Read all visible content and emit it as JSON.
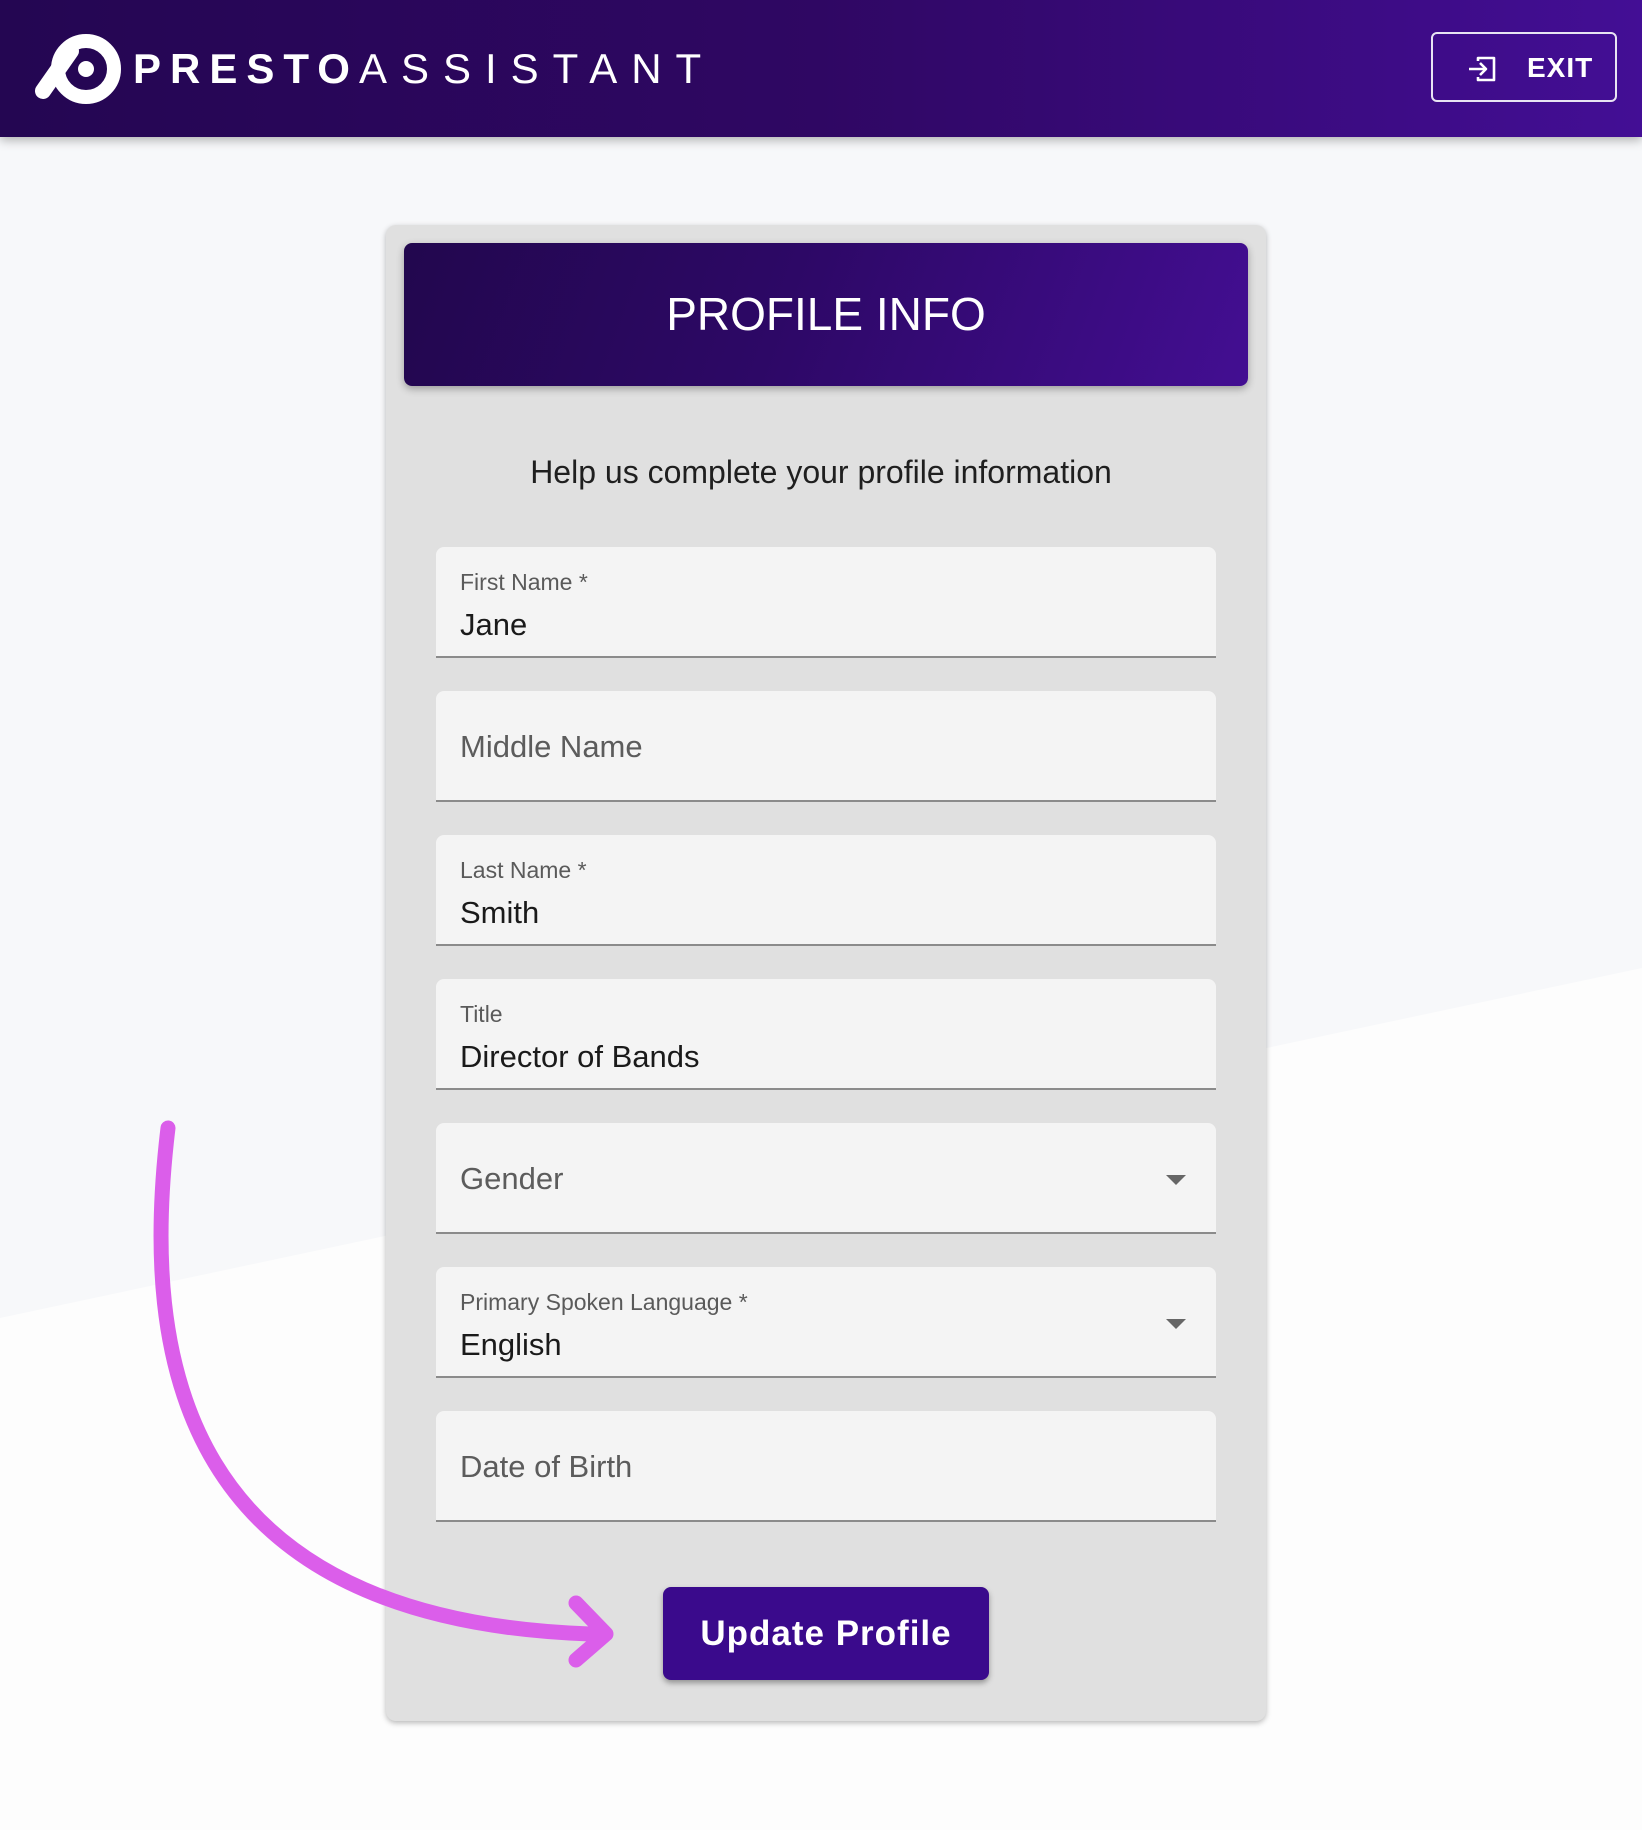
{
  "header": {
    "brand_bold": "PRESTO",
    "brand_light": "ASSISTANT",
    "logo_icon": "presto-logo-icon",
    "exit_label": "EXIT",
    "exit_icon": "exit-icon"
  },
  "card": {
    "title": "PROFILE INFO",
    "subtitle": "Help us complete your profile information"
  },
  "form": {
    "first_name": {
      "label": "First Name *",
      "value": "Jane"
    },
    "middle_name": {
      "placeholder": "Middle Name"
    },
    "last_name": {
      "label": "Last Name *",
      "value": "Smith"
    },
    "title": {
      "label": "Title",
      "value": "Director of Bands"
    },
    "gender": {
      "placeholder": "Gender",
      "icon": "caret-down-icon"
    },
    "language": {
      "label": "Primary Spoken Language *",
      "value": "English",
      "icon": "caret-down-icon"
    },
    "dob": {
      "placeholder": "Date of Birth"
    },
    "submit_label": "Update Profile"
  },
  "annotation": {
    "arrow_icon": "curved-arrow-icon",
    "arrow_color": "#db5eea"
  },
  "colors": {
    "brand_purple": "#3a0a8c",
    "header_gradient_start": "#240652",
    "header_gradient_end": "#430e95",
    "card_bg": "#e0e0e0",
    "field_bg": "#f4f4f4",
    "page_bg_upper": "#f7f8fa",
    "page_bg_lower": "#fdfdfd"
  }
}
